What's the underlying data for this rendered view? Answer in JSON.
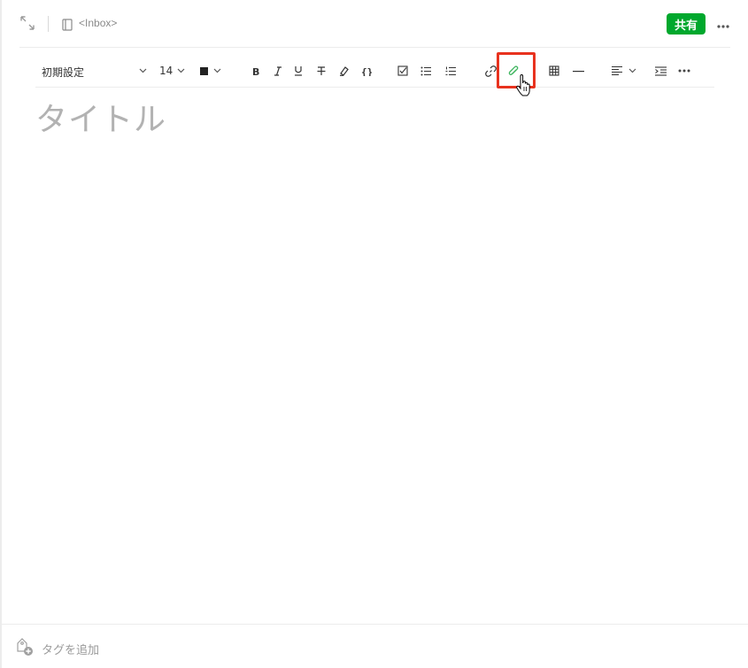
{
  "header": {
    "notebook_name": "<Inbox>",
    "share_label": "共有"
  },
  "toolbar": {
    "font_family": "初期設定",
    "font_size": "14"
  },
  "editor": {
    "title_placeholder": "タイトル"
  },
  "footer": {
    "add_tag_label": "タグを追加"
  },
  "colors": {
    "accent": "#00a82d",
    "highlight_box": "#e8321e",
    "attachment_icon": "#3fb55f"
  }
}
